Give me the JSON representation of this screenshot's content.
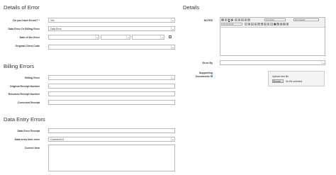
{
  "sections": {
    "details_of_error": "Details of Error",
    "details": "Details",
    "billing_errors": "Billing Errors",
    "data_entry_errors": "Data Entry Errors"
  },
  "details_of_error": {
    "errors_label": "Do you have Errors?",
    "errors_value": "Yes",
    "error_type_label": "Data Error Or Billing Error",
    "error_type_value": "Data Error",
    "date_label": "Date of the Error",
    "client_code_label": "Original Client Code"
  },
  "billing": {
    "billing_error_label": "Billing Error",
    "original_receipt_label": "Original Receipt Number",
    "returned_receipt_label": "Returned Receipt Number",
    "corrected_receipt_label": "Corrected Receipt"
  },
  "data_entry": {
    "data_error_receipt_label": "Data Error Receipt",
    "item_error_label": "Data entry item error",
    "item_error_value": "Comment #1",
    "correct_item_label": "Correct Item"
  },
  "details": {
    "notes_label": "NOTES",
    "font_size_placeholder": "Font Size",
    "font_family_placeholder": "Font Family",
    "font_format_placeholder": "Font Format",
    "error_by_label": "Error By",
    "supporting_docs_label_1": "Supporting",
    "supporting_docs_label_2": "Documents",
    "upload_title": "Upload new file",
    "browse_label": "Browse...",
    "no_file_text": "No file selected."
  },
  "colors": {
    "required": "#cc0000",
    "info": "#3a7fc1"
  }
}
